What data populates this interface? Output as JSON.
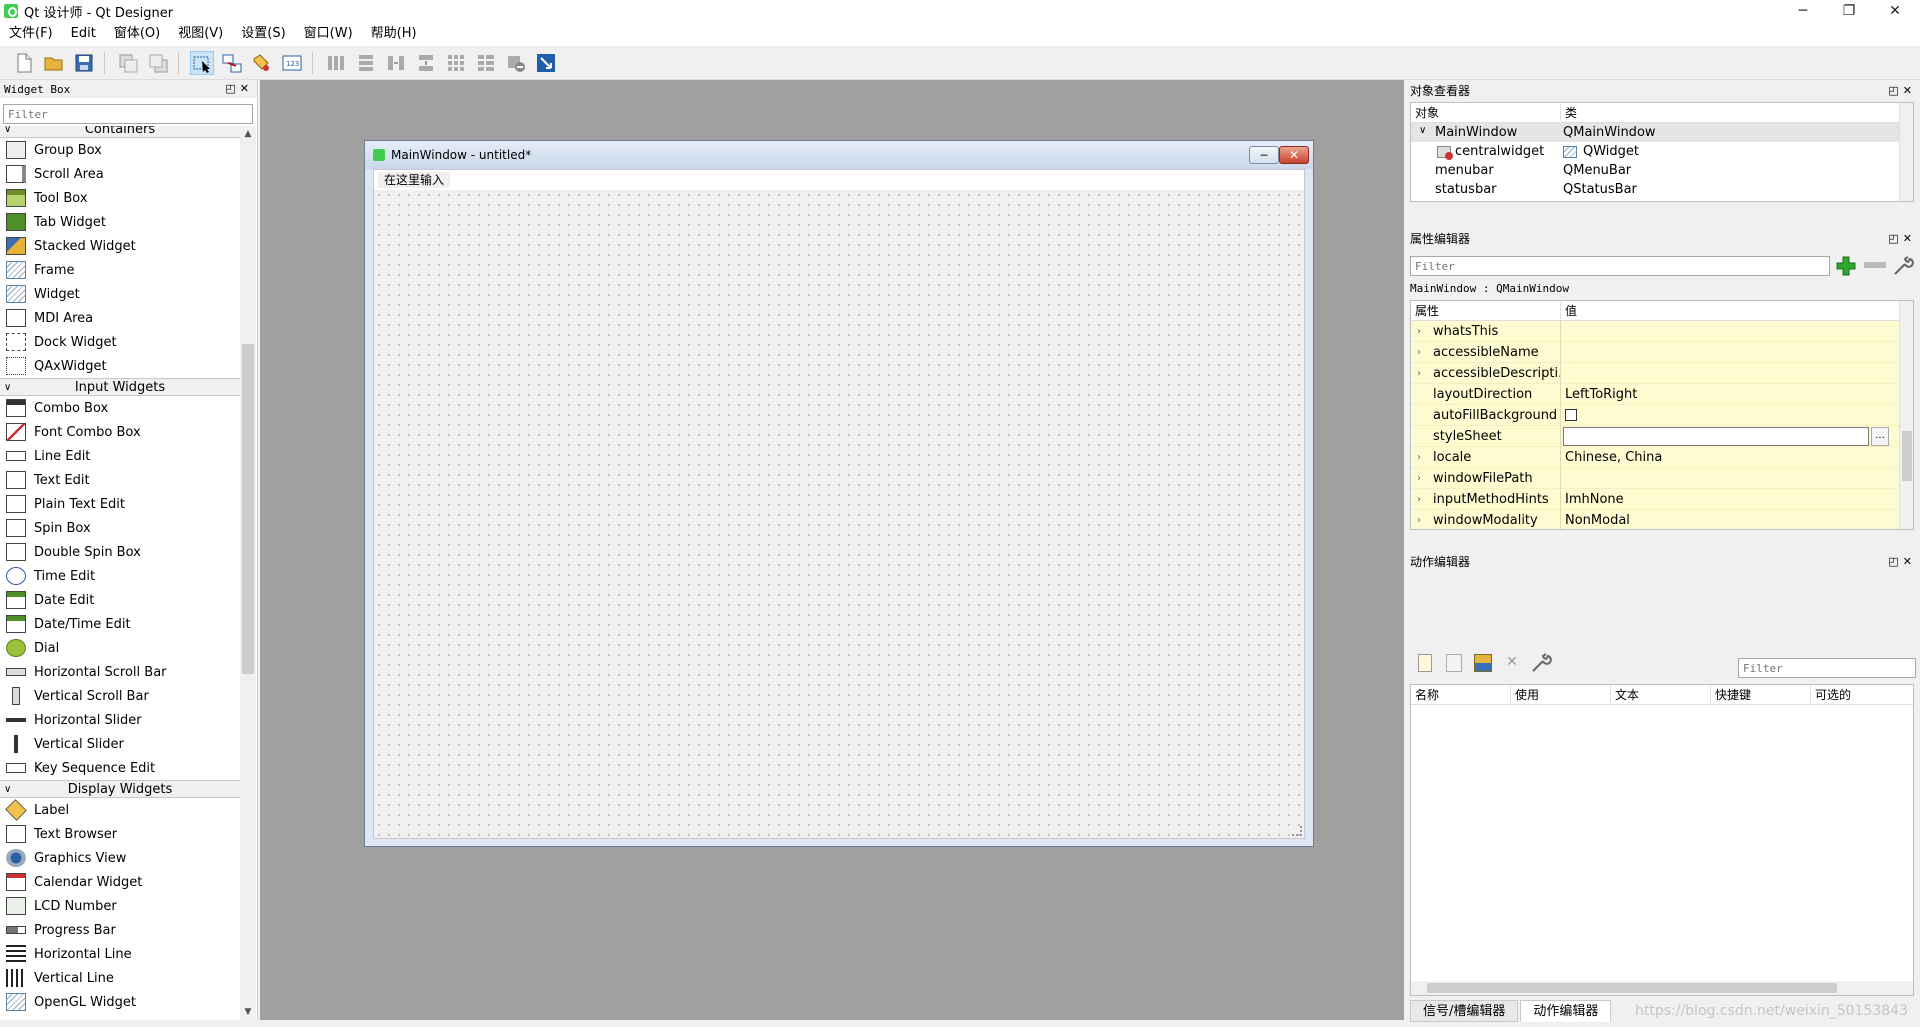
{
  "window": {
    "title": "Qt 设计师 - Qt Designer",
    "minimize": "─",
    "maximize": "❐",
    "close": "✕"
  },
  "menubar": {
    "items": [
      "文件(F)",
      "Edit",
      "窗体(O)",
      "视图(V)",
      "设置(S)",
      "窗口(W)",
      "帮助(H)"
    ]
  },
  "widget_box": {
    "title": "Widget Box",
    "filter_placeholder": "Filter",
    "categories": [
      {
        "name": "Containers",
        "items": [
          "Group Box",
          "Scroll Area",
          "Tool Box",
          "Tab Widget",
          "Stacked Widget",
          "Frame",
          "Widget",
          "MDI Area",
          "Dock Widget",
          "QAxWidget"
        ]
      },
      {
        "name": "Input Widgets",
        "items": [
          "Combo Box",
          "Font Combo Box",
          "Line Edit",
          "Text Edit",
          "Plain Text Edit",
          "Spin Box",
          "Double Spin Box",
          "Time Edit",
          "Date Edit",
          "Date/Time Edit",
          "Dial",
          "Horizontal Scroll Bar",
          "Vertical Scroll Bar",
          "Horizontal Slider",
          "Vertical Slider",
          "Key Sequence Edit"
        ]
      },
      {
        "name": "Display Widgets",
        "items": [
          "Label",
          "Text Browser",
          "Graphics View",
          "Calendar Widget",
          "LCD Number",
          "Progress Bar",
          "Horizontal Line",
          "Vertical Line",
          "OpenGL Widget"
        ]
      }
    ]
  },
  "form_window": {
    "title": "MainWindow - untitled*",
    "menu_placeholder": "在这里输入"
  },
  "object_inspector": {
    "title": "对象查看器",
    "col_object": "对象",
    "col_class": "类",
    "rows": [
      {
        "object": "MainWindow",
        "class": "QMainWindow"
      },
      {
        "object": "centralwidget",
        "class": "QWidget"
      },
      {
        "object": "menubar",
        "class": "QMenuBar"
      },
      {
        "object": "statusbar",
        "class": "QStatusBar"
      }
    ]
  },
  "property_editor": {
    "title": "属性编辑器",
    "filter_placeholder": "Filter",
    "info": "MainWindow : QMainWindow",
    "col_property": "属性",
    "col_value": "值",
    "rows": [
      {
        "name": "whatsThis",
        "value": "",
        "expandable": true
      },
      {
        "name": "accessibleName",
        "value": "",
        "expandable": true
      },
      {
        "name": "accessibleDescripti...",
        "value": "",
        "expandable": true
      },
      {
        "name": "layoutDirection",
        "value": "LeftToRight",
        "expandable": false
      },
      {
        "name": "autoFillBackground",
        "value": "",
        "expandable": false
      },
      {
        "name": "styleSheet",
        "value": "",
        "expandable": false
      },
      {
        "name": "locale",
        "value": "Chinese, China",
        "expandable": true
      },
      {
        "name": "windowFilePath",
        "value": "",
        "expandable": true
      },
      {
        "name": "inputMethodHints",
        "value": "ImhNone",
        "expandable": true
      },
      {
        "name": "windowModality",
        "value": "NonModal",
        "expandable": true
      }
    ],
    "stylesheet_button": "..."
  },
  "action_editor": {
    "title": "动作编辑器",
    "filter_placeholder": "Filter",
    "columns": [
      "名称",
      "使用",
      "文本",
      "快捷键",
      "可选的"
    ]
  },
  "bottom_tabs": [
    "信号/槽编辑器",
    "动作编辑器"
  ],
  "watermark": "https://blog.csdn.net/weixin_50153843",
  "colors": {
    "mdi_background": "#a0a0a0",
    "property_row": "#fffbd0",
    "selection": "#e5e5e5",
    "accent": "#41cd52"
  }
}
